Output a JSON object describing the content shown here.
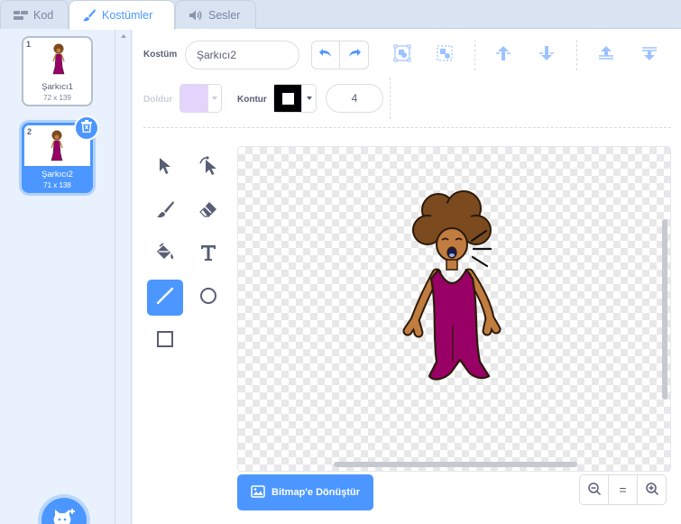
{
  "tabs": [
    {
      "label": "Kod",
      "icon": "code-icon",
      "active": false
    },
    {
      "label": "Kostümler",
      "icon": "brush-icon",
      "active": true
    },
    {
      "label": "Sesler",
      "icon": "speaker-icon",
      "active": false
    }
  ],
  "costumes": [
    {
      "number": "1",
      "name": "Şarkıcı1",
      "size": "72 x 139",
      "selected": false
    },
    {
      "number": "2",
      "name": "Şarkıcı2",
      "size": "71 x 138",
      "selected": true
    }
  ],
  "toolbar": {
    "costume_label": "Kostüm",
    "costume_name": "Şarkıcı2",
    "fill_label": "Doldur",
    "outline_label": "Kontur",
    "outline_width": "4",
    "fill_color": "#e3d4fb",
    "outline_color": "#000000"
  },
  "tools": [
    "select-tool",
    "reshape-tool",
    "brush-tool",
    "eraser-tool",
    "fill-tool",
    "text-tool",
    "line-tool",
    "circle-tool",
    "rectangle-tool"
  ],
  "active_tool": "line-tool",
  "bottom": {
    "convert_label": "Bitmap'e Dönüştür",
    "zoom_reset": "="
  },
  "colors": {
    "accent": "#4c97ff",
    "dress": "#990066",
    "skin": "#c17c3f",
    "hair": "#7b4a1f"
  }
}
